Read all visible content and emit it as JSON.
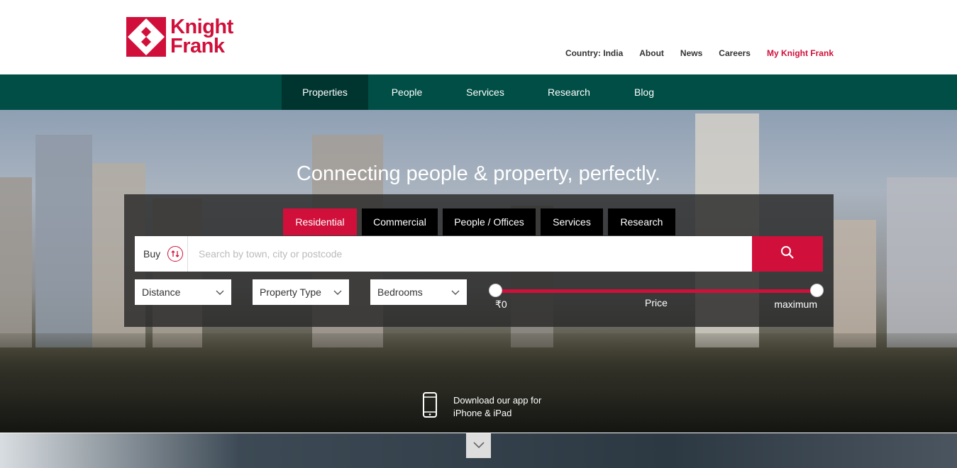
{
  "brand": {
    "name_line1": "Knight",
    "name_line2": "Frank",
    "color": "#d0103a"
  },
  "top_links": [
    {
      "label": "Country: India"
    },
    {
      "label": "About"
    },
    {
      "label": "News"
    },
    {
      "label": "Careers"
    },
    {
      "label": "My Knight Frank"
    }
  ],
  "nav": {
    "color": "#004e45",
    "items": [
      {
        "label": "Properties",
        "active": true
      },
      {
        "label": "People"
      },
      {
        "label": "Services"
      },
      {
        "label": "Research"
      },
      {
        "label": "Blog"
      }
    ]
  },
  "hero": {
    "title": "Connecting people & property, perfectly."
  },
  "search": {
    "tabs": [
      {
        "label": "Residential",
        "active": true
      },
      {
        "label": "Commercial"
      },
      {
        "label": "People / Offices"
      },
      {
        "label": "Services"
      },
      {
        "label": "Research"
      }
    ],
    "mode_label": "Buy",
    "mode_icon": "swap-arrows-icon",
    "placeholder": "Search by town, city or postcode",
    "button_icon": "search-icon",
    "filters": [
      {
        "label": "Distance"
      },
      {
        "label": "Property Type"
      },
      {
        "label": "Bedrooms"
      }
    ],
    "price": {
      "label": "Price",
      "min_label": "₹0",
      "max_label": "maximum"
    }
  },
  "app_promo": {
    "line1": "Download our app for",
    "line2": "iPhone & iPad",
    "icon": "phone-icon"
  },
  "scroll_icon": "chevron-down-icon"
}
